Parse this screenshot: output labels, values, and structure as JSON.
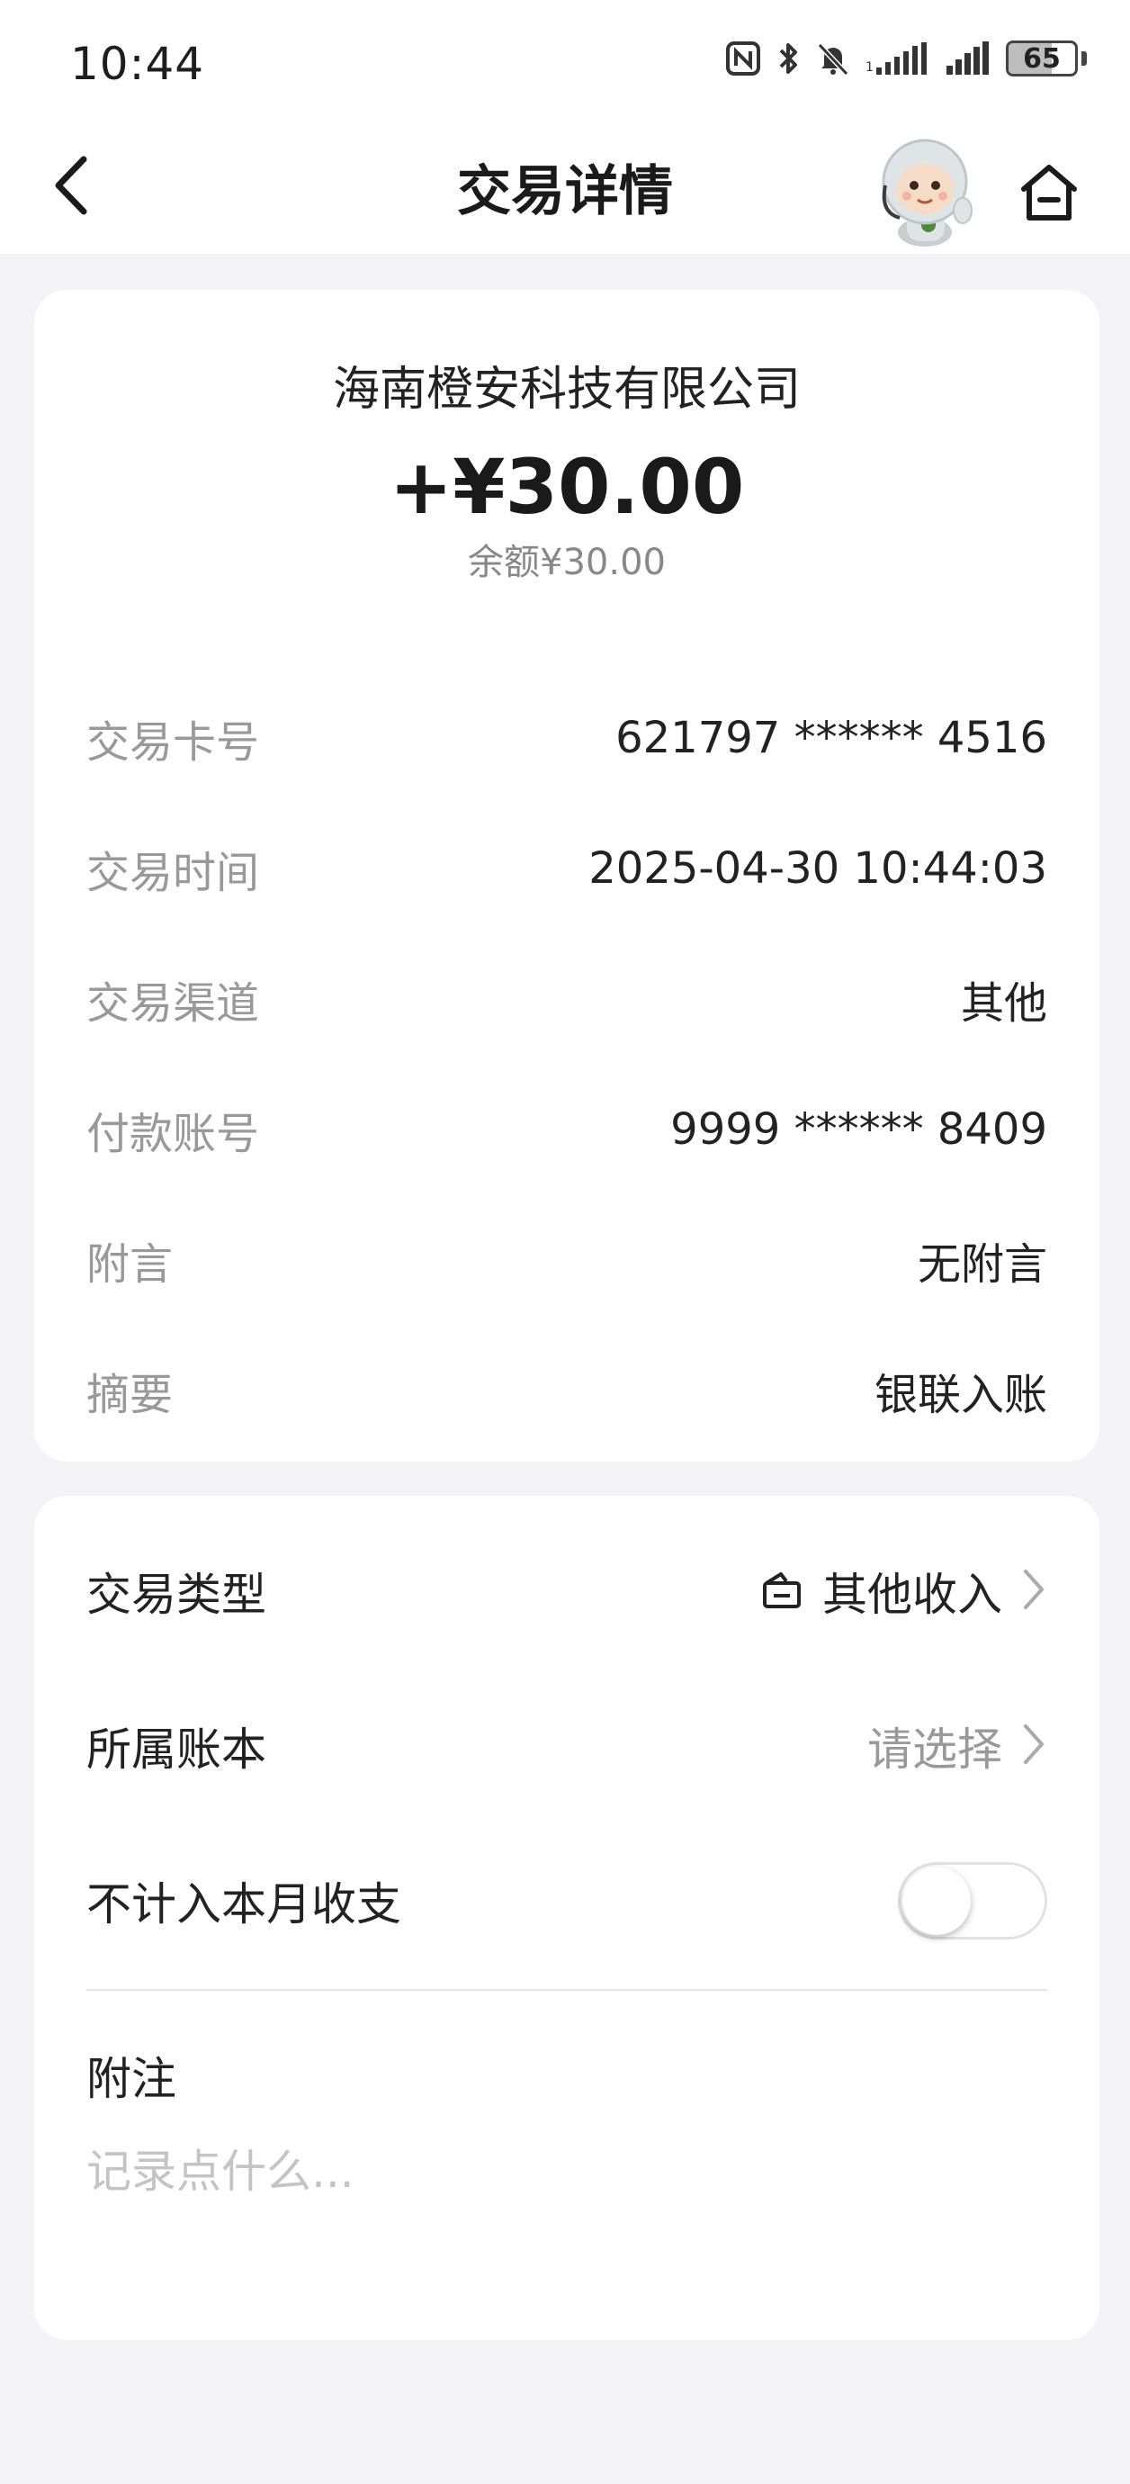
{
  "status_bar": {
    "time": "10:44",
    "battery_level": "65",
    "battery_fraction": 0.65,
    "icons": [
      "nfc-icon",
      "bluetooth-icon",
      "mute-bell-icon",
      "signal-icon",
      "signal-icon",
      "battery-icon"
    ]
  },
  "nav": {
    "title": "交易详情",
    "back_icon": "chevron-left-icon",
    "mascot_icon": "assistant-mascot-icon",
    "home_icon": "home-icon"
  },
  "summary": {
    "merchant": "海南橙安科技有限公司",
    "amount": "+¥30.00",
    "balance": "余额¥30.00"
  },
  "details": [
    {
      "label": "交易卡号",
      "value": "621797 ****** 4516"
    },
    {
      "label": "交易时间",
      "value": "2025-04-30 10:44:03"
    },
    {
      "label": "交易渠道",
      "value": "其他"
    },
    {
      "label": "付款账号",
      "value": "9999 ****** 8409"
    },
    {
      "label": "附言",
      "value": "无附言"
    },
    {
      "label": "摘要",
      "value": "银联入账"
    }
  ],
  "settings": {
    "transaction_type": {
      "label": "交易类型",
      "value": "其他收入",
      "icon": "wallet-icon"
    },
    "account_book": {
      "label": "所属账本",
      "placeholder_value": "请选择"
    },
    "exclude_monthly": {
      "label": "不计入本月收支",
      "enabled": false
    },
    "note": {
      "label": "附注",
      "placeholder": "记录点什么...",
      "value": ""
    }
  },
  "colors": {
    "background": "#f3f3f8",
    "card": "#ffffff",
    "text_primary": "#222222",
    "text_secondary": "#999999"
  }
}
